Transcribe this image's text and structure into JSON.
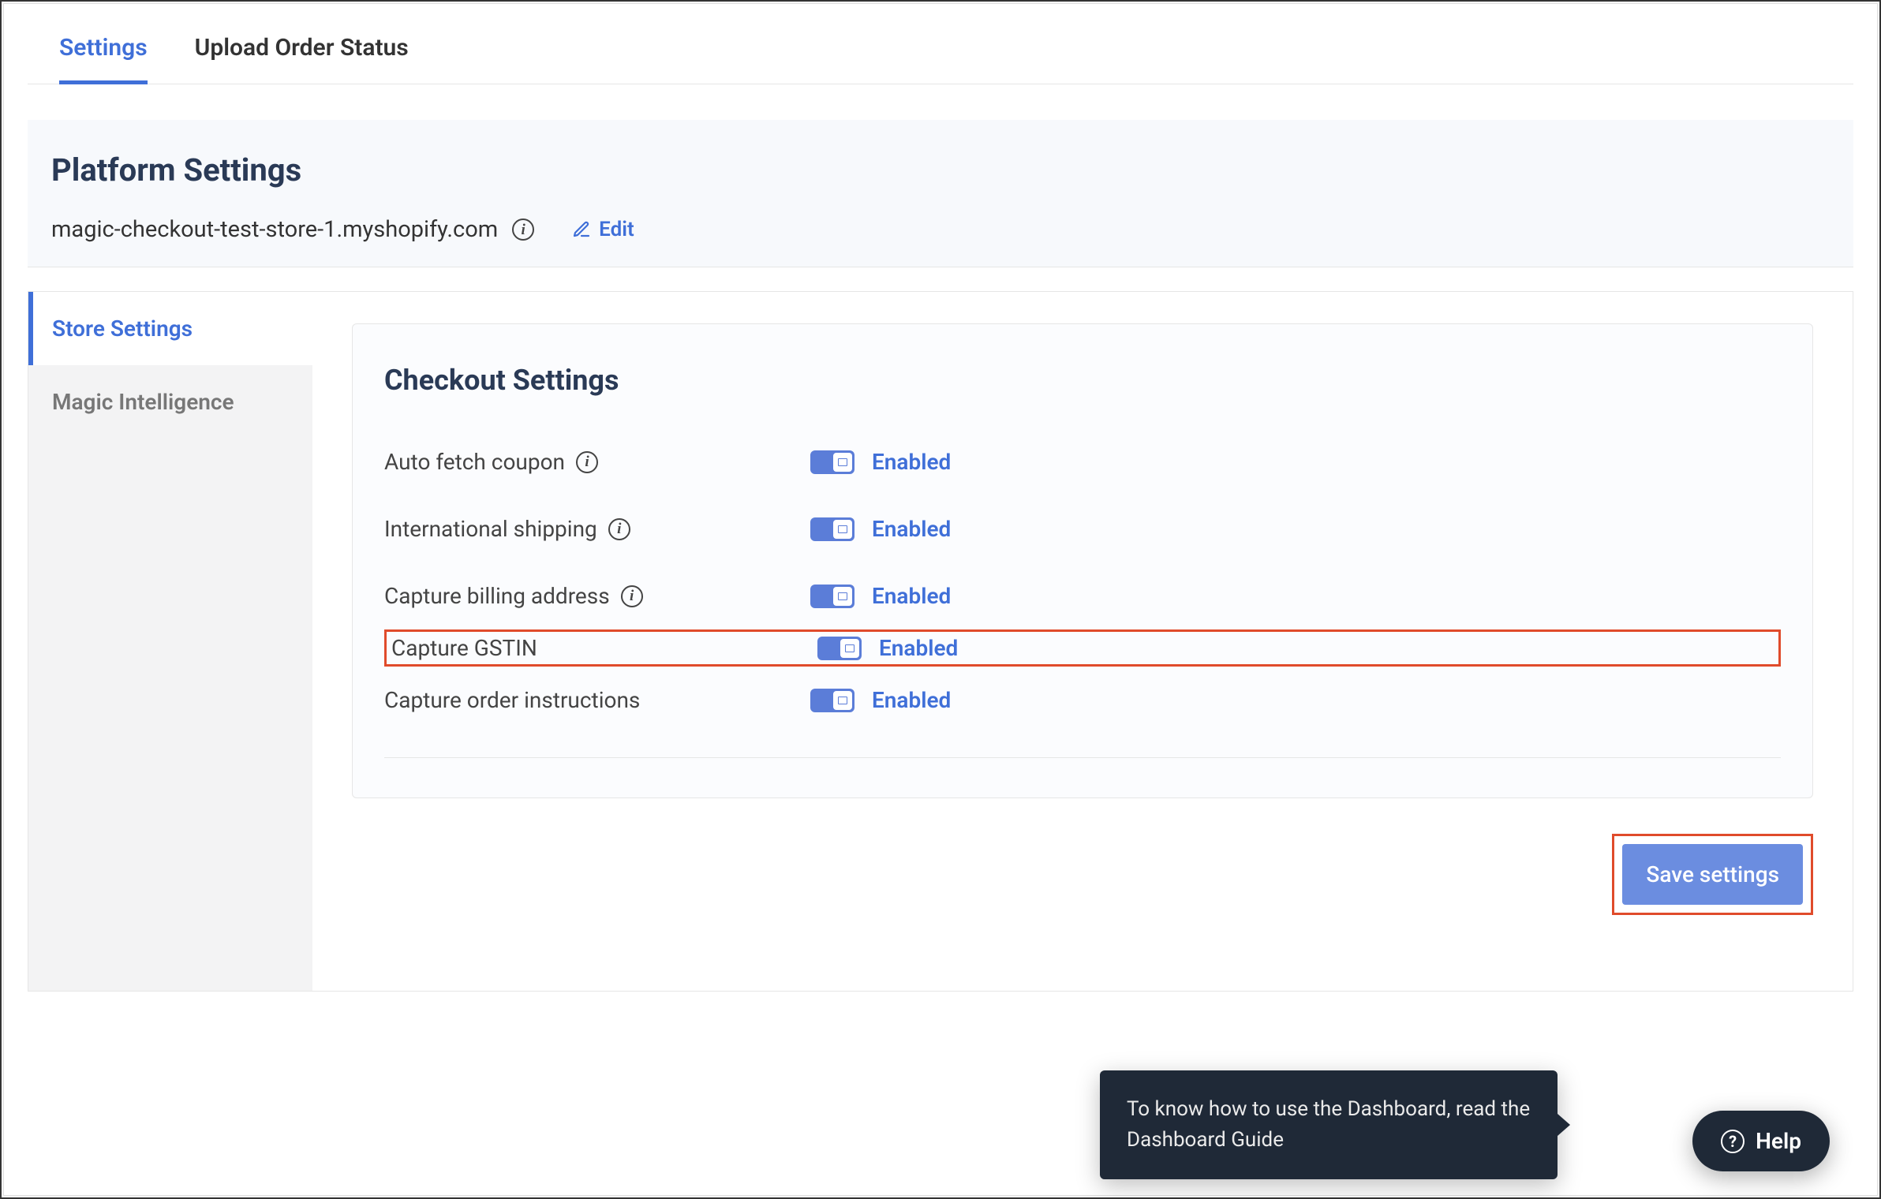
{
  "tabs": {
    "settings": "Settings",
    "upload": "Upload Order Status"
  },
  "platform": {
    "title": "Platform Settings",
    "domain": "magic-checkout-test-store-1.myshopify.com",
    "edit": "Edit"
  },
  "sidebar": {
    "items": [
      {
        "label": "Store Settings",
        "active": true
      },
      {
        "label": "Magic Intelligence",
        "active": false
      }
    ]
  },
  "checkout": {
    "title": "Checkout Settings",
    "rows": [
      {
        "label": "Auto fetch coupon",
        "info": true,
        "status": "Enabled",
        "highlight": false
      },
      {
        "label": "International shipping",
        "info": true,
        "status": "Enabled",
        "highlight": false
      },
      {
        "label": "Capture billing address",
        "info": true,
        "status": "Enabled",
        "highlight": false
      },
      {
        "label": "Capture GSTIN",
        "info": false,
        "status": "Enabled",
        "highlight": true
      },
      {
        "label": "Capture order instructions",
        "info": false,
        "status": "Enabled",
        "highlight": false
      }
    ]
  },
  "save_button": "Save settings",
  "tooltip": "To know how to use the Dashboard, read the Dashboard Guide",
  "help": "Help"
}
